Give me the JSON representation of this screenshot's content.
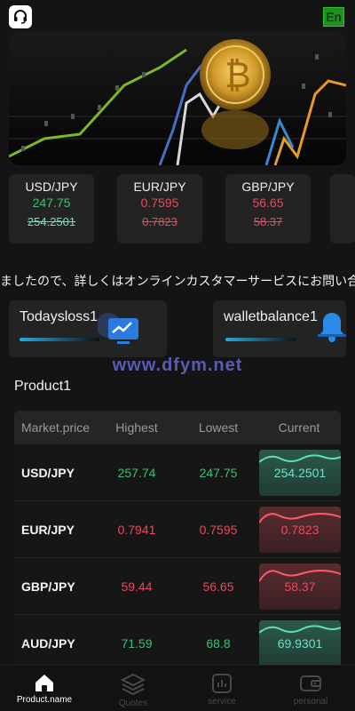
{
  "header": {
    "lang_label": "En"
  },
  "tickers": [
    {
      "pair": "USD/JPY",
      "price": "247.75",
      "prev": "254.2501",
      "direction": "up"
    },
    {
      "pair": "EUR/JPY",
      "price": "0.7595",
      "prev": "0.7823",
      "direction": "down"
    },
    {
      "pair": "GBP/JPY",
      "price": "56.65",
      "prev": "58.37",
      "direction": "down"
    }
  ],
  "notice": "ましたので、詳しくはオンラインカスタマーサービスにお問い合わ",
  "stats": {
    "today_loss_label": "Todaysloss1",
    "wallet_balance_label": "walletbalance1"
  },
  "watermark": "www.dfym.net",
  "product_section": {
    "title": "Product1",
    "columns": [
      "Market.price",
      "Highest",
      "Lowest",
      "Current"
    ],
    "rows": [
      {
        "pair": "USD/JPY",
        "highest": "257.74",
        "lowest": "247.75",
        "current": "254.2501",
        "direction": "up"
      },
      {
        "pair": "EUR/JPY",
        "highest": "0.7941",
        "lowest": "0.7595",
        "current": "0.7823",
        "direction": "down"
      },
      {
        "pair": "GBP/JPY",
        "highest": "59.44",
        "lowest": "56.65",
        "current": "58.37",
        "direction": "down"
      },
      {
        "pair": "AUD/JPY",
        "highest": "71.59",
        "lowest": "68.8",
        "current": "69.9301",
        "direction": "up"
      }
    ]
  },
  "tabs": [
    {
      "label": "Product.name",
      "icon": "home-icon",
      "active": true
    },
    {
      "label": "Quotes",
      "icon": "layers-icon",
      "active": false
    },
    {
      "label": "service",
      "icon": "chart-box-icon",
      "active": false
    },
    {
      "label": "personal",
      "icon": "wallet-icon",
      "active": false
    }
  ],
  "colors": {
    "up": "#38c172",
    "down": "#e84a5f",
    "accent_blue": "#2aa8e0"
  }
}
